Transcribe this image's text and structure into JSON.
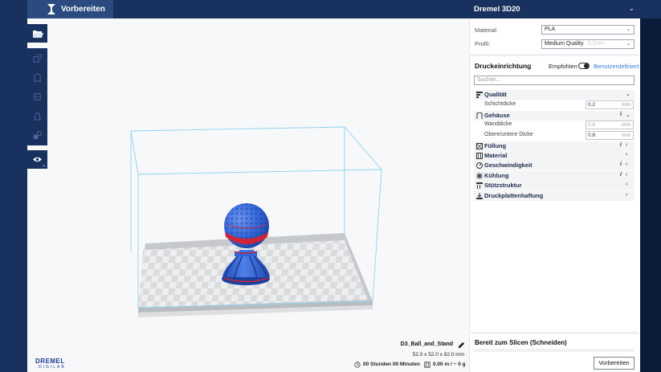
{
  "header": {
    "tab_label": "Vorbereiten",
    "printer_name": "Dremel 3D20"
  },
  "settings": {
    "material_label": "Material:",
    "material_value": "PLA",
    "profile_label": "Profil:",
    "profile_value": "Medium Quality",
    "profile_hint": "0.2mm"
  },
  "print_setup": {
    "title": "Druckeinrichtung",
    "recommended_label": "Empfohlen",
    "custom_label": "Benutzerdefiniert",
    "search_placeholder": "Suchen..."
  },
  "categories": {
    "quality": "Qualität",
    "layer_height": "Schichtdicke",
    "layer_height_value": "0.2",
    "shell": "Gehäuse",
    "wall_thickness": "Wanddicke",
    "wall_thickness_value": "0.8",
    "top_bottom": "Obere/untere Dicke",
    "top_bottom_value": "0.8",
    "infill": "Füllung",
    "material": "Material",
    "speed": "Geschwindigkeit",
    "cooling": "Kühlung",
    "support": "Stützstruktur",
    "adhesion": "Druckplattenhaftung",
    "unit_mm": "mm",
    "info_glyph": "i"
  },
  "object": {
    "name": "D3_Ball_and_Stand",
    "dimensions": "52.0 x 52.0 x 82.0 mm",
    "print_time": "00 Stunden 00 Minuten",
    "material_usage": "0.00 m / ~ 0 g"
  },
  "slice": {
    "status": "Bereit zum Slicen (Schneiden)",
    "button_label": "Vorbereiten"
  },
  "brand": {
    "line1": "DREMEL",
    "line2": "DIGILAB"
  },
  "colors": {
    "header_bg": "#18315f",
    "accent": "#3a7ad8",
    "model_blue": "#2f63d6",
    "model_red": "#e0202a",
    "build_volume": "#8ed2f0"
  },
  "icons": [
    "folder-open-icon",
    "scale-icon",
    "move-icon",
    "rotate-icon",
    "mirror-icon",
    "per-model-settings-icon",
    "eye-icon",
    "pencil-icon",
    "clock-icon",
    "spool-icon"
  ]
}
